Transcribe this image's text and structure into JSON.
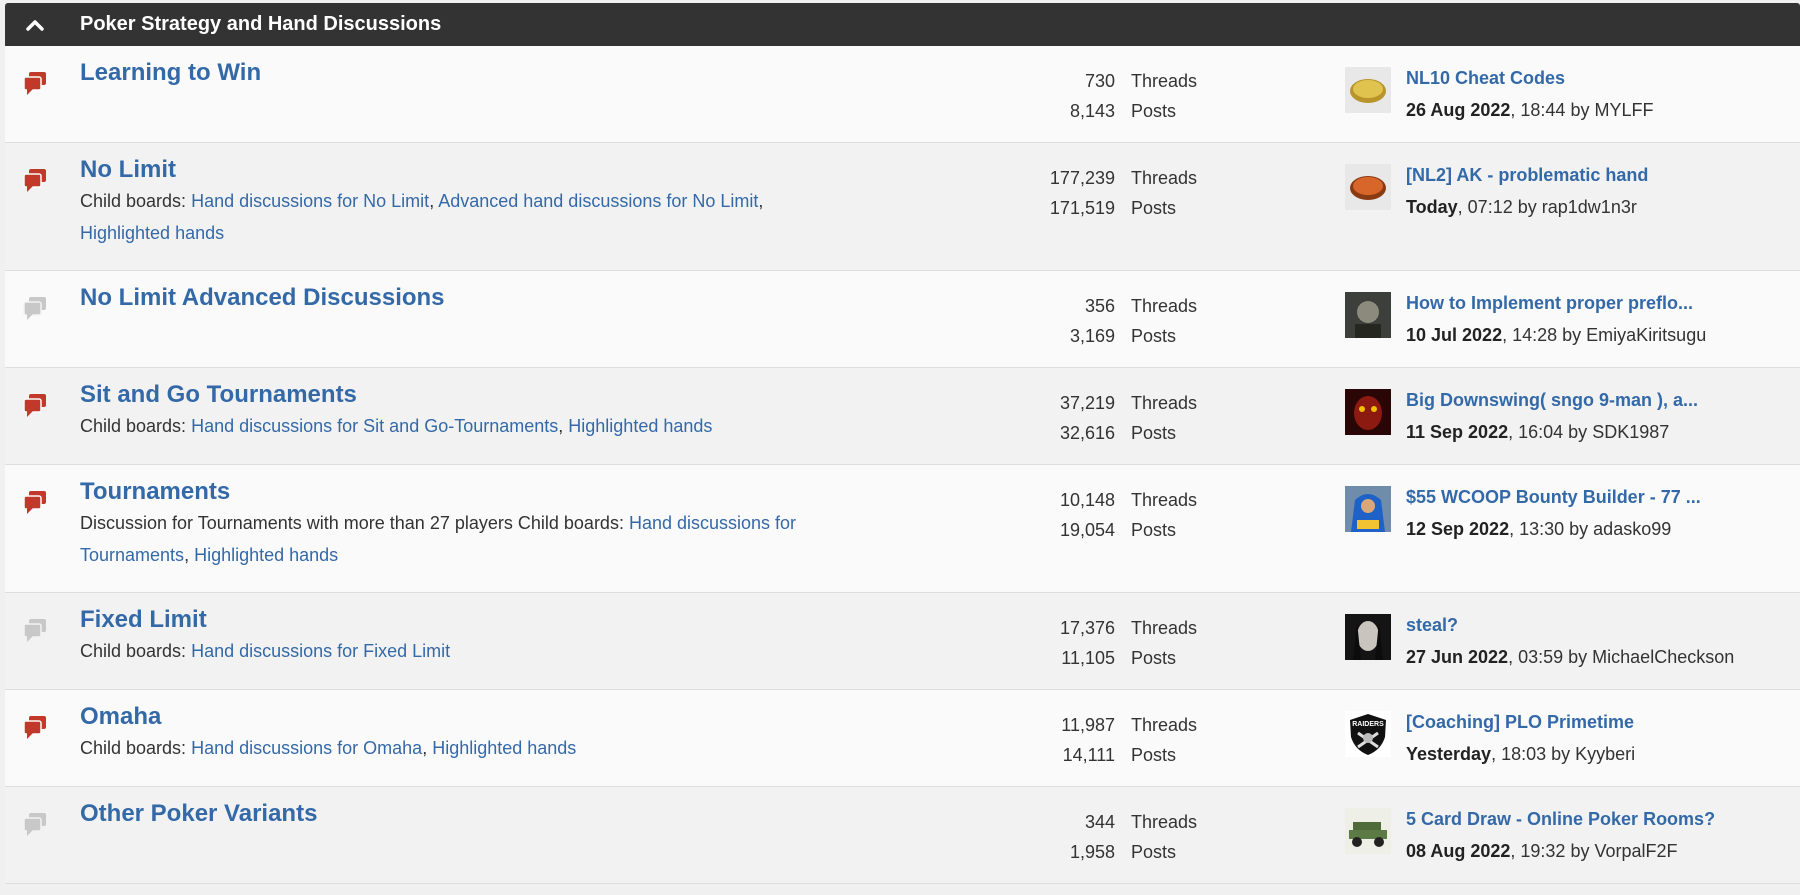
{
  "category": {
    "title": "Poker Strategy and Hand Discussions"
  },
  "labels": {
    "threads": "Threads",
    "posts": "Posts",
    "child_boards": "Child boards:",
    "by": "by"
  },
  "colors": {
    "header_bg": "#333333",
    "link": "#3469a8",
    "icon_active": "#c0392b",
    "icon_inactive": "#c8c8c8"
  },
  "boards": [
    {
      "title": "Learning to Win",
      "icon": "chat-bubbles-icon",
      "active": true,
      "threads": "730",
      "posts": "8,143",
      "last": {
        "title": "NL10 Cheat Codes",
        "date": "26 Aug 2022",
        "time": ", 18:44",
        "user": "MYLFF",
        "avatar": "gold-coin-avatar"
      }
    },
    {
      "title": "No Limit",
      "icon": "chat-bubbles-icon",
      "active": true,
      "threads": "177,239",
      "posts": "171,519",
      "child_boards": [
        "Hand discussions for No Limit",
        "Advanced hand discussions for No Limit",
        "Highlighted hands"
      ],
      "last": {
        "title": "[NL2] AK - problematic hand",
        "date": "Today",
        "time": ", 07:12",
        "user": "rap1dw1n3r",
        "avatar": "orange-coin-avatar"
      }
    },
    {
      "title": "No Limit Advanced Discussions",
      "icon": "chat-bubbles-icon",
      "active": false,
      "threads": "356",
      "posts": "3,169",
      "last": {
        "title": "How to Implement proper preflo...",
        "date": "10 Jul 2022",
        "time": ", 14:28",
        "user": "EmiyaKiritsugu",
        "avatar": "anime-avatar"
      }
    },
    {
      "title": "Sit and Go Tournaments",
      "icon": "chat-bubbles-icon",
      "active": true,
      "threads": "37,219",
      "posts": "32,616",
      "child_boards": [
        "Hand discussions for Sit and Go-Tournaments",
        "Highlighted hands"
      ],
      "last": {
        "title": "Big Downswing( sngo 9-man ), a...",
        "date": "11 Sep 2022",
        "time": ", 16:04",
        "user": "SDK1987",
        "avatar": "red-mask-avatar"
      }
    },
    {
      "title": "Tournaments",
      "icon": "chat-bubbles-icon",
      "active": true,
      "threads": "10,148",
      "posts": "19,054",
      "description": "Discussion for Tournaments with more than 27 players",
      "child_boards": [
        "Hand discussions for Tournaments",
        "Highlighted hands"
      ],
      "last": {
        "title": "$55 WCOOP Bounty Builder - 77 ...",
        "date": "12 Sep 2022",
        "time": ", 13:30",
        "user": "adasko99",
        "avatar": "blue-hoodie-avatar"
      }
    },
    {
      "title": "Fixed Limit",
      "icon": "chat-bubbles-icon",
      "active": false,
      "threads": "17,376",
      "posts": "11,105",
      "child_boards": [
        "Hand discussions for Fixed Limit"
      ],
      "last": {
        "title": "steal?",
        "date": "27 Jun 2022",
        "time": ", 03:59",
        "user": "MichaelCheckson",
        "avatar": "dark-face-avatar"
      }
    },
    {
      "title": "Omaha",
      "icon": "chat-bubbles-icon",
      "active": true,
      "threads": "11,987",
      "posts": "14,111",
      "child_boards": [
        "Hand discussions for Omaha",
        "Highlighted hands"
      ],
      "last": {
        "title": "[Coaching] PLO Primetime",
        "date": "Yesterday",
        "time": ", 18:03",
        "user": "Kyyberi",
        "avatar": "raiders-logo-avatar",
        "avatar_text": "RAIDERS"
      }
    },
    {
      "title": "Other Poker Variants",
      "icon": "chat-bubbles-icon",
      "active": false,
      "threads": "344",
      "posts": "1,958",
      "last": {
        "title": "5 Card Draw - Online Poker Rooms?",
        "date": "08 Aug 2022",
        "time": ", 19:32",
        "user": "VorpalF2F",
        "avatar": "green-jeep-avatar"
      }
    }
  ]
}
